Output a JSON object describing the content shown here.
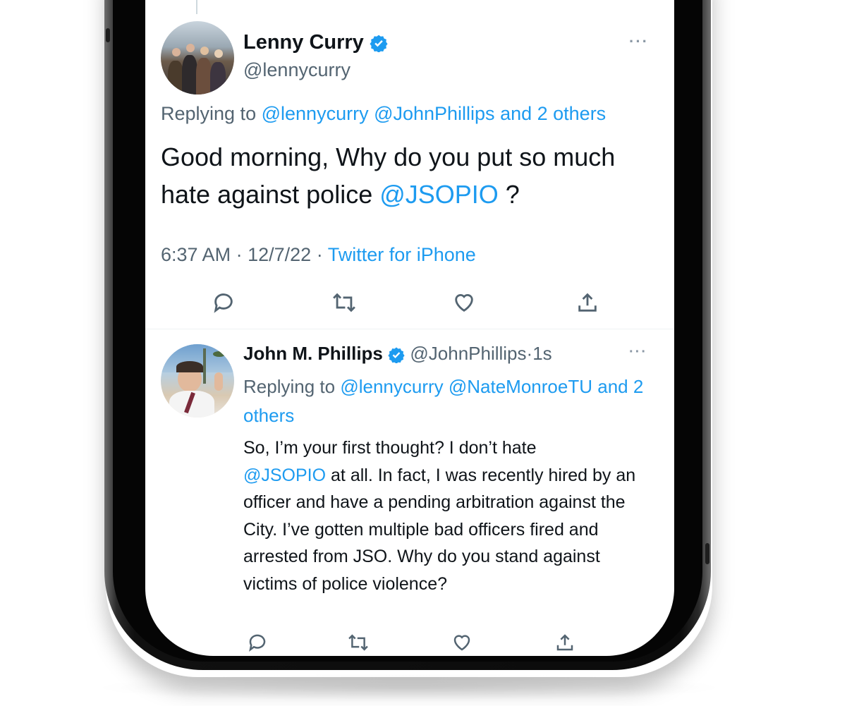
{
  "tweet_main": {
    "author_name": "Lenny Curry",
    "author_handle": "@lennycurry",
    "more_label": "···",
    "replying_prefix": "Replying to",
    "replying_mentions": "@lennycurry @JohnPhillips",
    "replying_and": "and 2 others",
    "text_before": "Good morning, Why do you put so much hate against police ",
    "text_mention": "@JSOPIO",
    "text_after": " ?",
    "time": "6:37 AM",
    "date": "12/7/22",
    "source": "Twitter for iPhone",
    "separator": "·"
  },
  "tweet_reply": {
    "author_name": "John M. Phillips",
    "author_handle": "@JohnPhillips",
    "time_ago": "1s",
    "separator": "·",
    "more_label": "···",
    "replying_prefix": "Replying to",
    "replying_mentions": "@lennycurry @NateMonroeTU",
    "replying_and": "and 2 others",
    "text_line1": "So, I’m your first thought? I don’t hate",
    "text_mention": "@JSOPIO",
    "text_rest": " at all. In fact, I was recently hired by an officer and have a pending arbitration against the City. I’ve gotten multiple bad officers fired and arrested from JSO. Why do you stand against victims of police violence?"
  },
  "actions": [
    "reply-icon",
    "retweet-icon",
    "like-icon",
    "share-icon"
  ],
  "colors": {
    "accent": "#1d9bf0",
    "text": "#0f1419",
    "muted": "#536471"
  }
}
